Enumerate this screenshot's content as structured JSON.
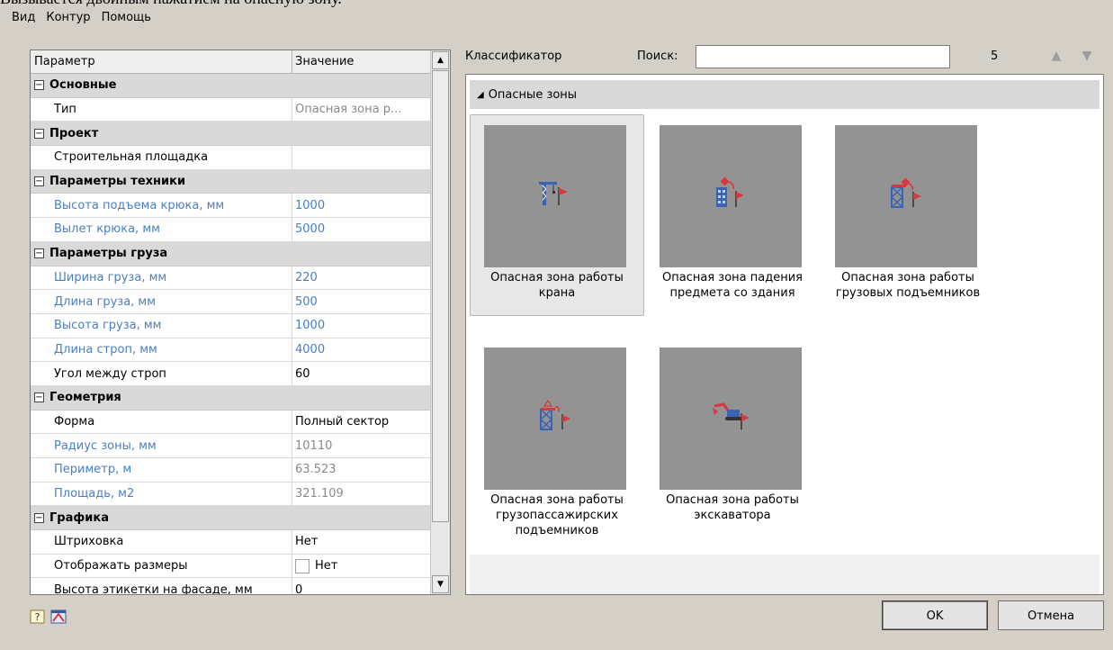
{
  "cutoff_text": "Вызывается двойным нажатием на опасную зону.",
  "menu": [
    "Вид",
    "Контур",
    "Помощь"
  ],
  "grid": {
    "headers": {
      "param": "Параметр",
      "value": "Значение"
    },
    "rows": [
      {
        "kind": "cat",
        "label": "Основные"
      },
      {
        "kind": "prop",
        "label": "Тип",
        "value": "Опасная зона р...",
        "style": "gray"
      },
      {
        "kind": "cat",
        "label": "Проект"
      },
      {
        "kind": "prop",
        "label": "Строительная площадка",
        "value": ""
      },
      {
        "kind": "cat",
        "label": "Параметры техники"
      },
      {
        "kind": "prop",
        "label": "Высота подъема крюка, мм",
        "value": "1000",
        "style": "blue"
      },
      {
        "kind": "prop",
        "label": "Вылет крюка, мм",
        "value": "5000",
        "style": "blue"
      },
      {
        "kind": "cat",
        "label": "Параметры груза"
      },
      {
        "kind": "prop",
        "label": "Ширина груза, мм",
        "value": "220",
        "style": "blue"
      },
      {
        "kind": "prop",
        "label": "Длина груза, мм",
        "value": "500",
        "style": "blue"
      },
      {
        "kind": "prop",
        "label": "Высота груза, мм",
        "value": "1000",
        "style": "blue"
      },
      {
        "kind": "prop",
        "label": "Длина строп, мм",
        "value": "4000",
        "style": "blue"
      },
      {
        "kind": "prop",
        "label": "Угол между строп",
        "value": "60"
      },
      {
        "kind": "cat",
        "label": "Геометрия"
      },
      {
        "kind": "prop",
        "label": "Форма",
        "value": "Полный сектор"
      },
      {
        "kind": "prop",
        "label": "Радиус зоны, мм",
        "value": "10110",
        "style": "blue-gray"
      },
      {
        "kind": "prop",
        "label": "Периметр, м",
        "value": "63.523",
        "style": "blue-gray"
      },
      {
        "kind": "prop",
        "label": "Площадь, м2",
        "value": "321.109",
        "style": "blue-gray"
      },
      {
        "kind": "cat",
        "label": "Графика"
      },
      {
        "kind": "prop",
        "label": "Штриховка",
        "value": "Нет"
      },
      {
        "kind": "prop",
        "label": "Отображать размеры",
        "value": "Нет",
        "checkbox": true
      },
      {
        "kind": "prop",
        "label": "Высота этикетки на фасаде, мм",
        "value": "0"
      }
    ]
  },
  "classifier": {
    "label": "Классификатор",
    "search_label": "Поиск:",
    "search_value": "",
    "count": "5",
    "group": "Опасные зоны",
    "items": [
      {
        "caption": "Опасная зона работы крана",
        "icon": "crane-icon",
        "selected": true
      },
      {
        "caption": "Опасная зона падения предмета со здания",
        "icon": "building-fall-icon",
        "selected": false
      },
      {
        "caption": "Опасная зона работы грузовых подъемников",
        "icon": "cargo-lift-icon",
        "selected": false
      },
      {
        "caption": "Опасная зона работы грузопассажирских подъемников",
        "icon": "passenger-lift-icon",
        "selected": false
      },
      {
        "caption": "Опасная зона работы экскаватора",
        "icon": "excavator-icon",
        "selected": false
      }
    ]
  },
  "buttons": {
    "ok": "OK",
    "cancel": "Отмена"
  },
  "colors": {
    "blue_text": "#4a7fc1",
    "gray_text": "#8a8a8a",
    "thumb_bg": "#939393",
    "accent_red": "#d9363e"
  }
}
